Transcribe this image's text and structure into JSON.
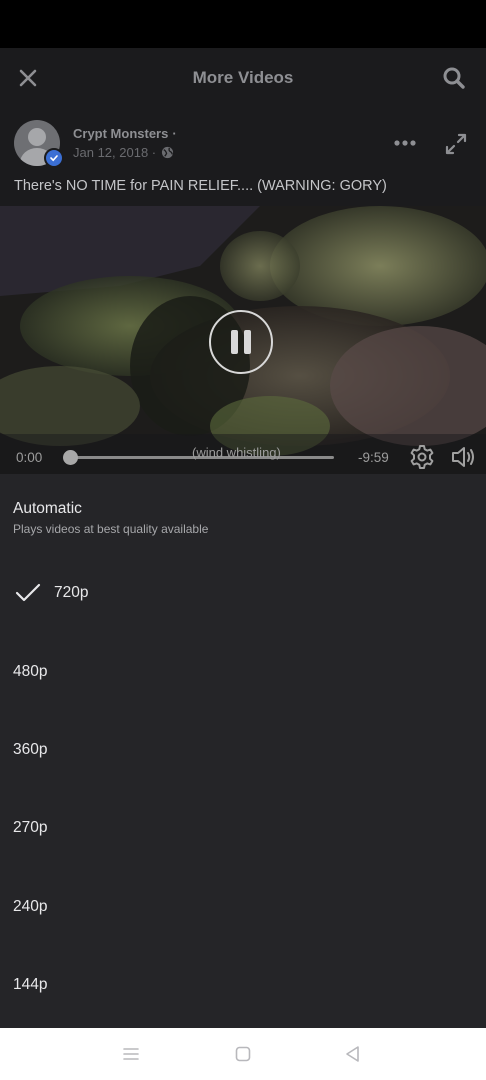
{
  "header": {
    "title": "More Videos",
    "close_icon": "close-icon",
    "search_icon": "search-icon"
  },
  "post": {
    "author": "Crypt Monsters",
    "author_separator": "·",
    "date": "Jan 12, 2018 ·",
    "audience_icon": "globe-icon",
    "verified_icon": "verified-badge-icon",
    "more_icon": "more-horizontal-icon",
    "expand_icon": "expand-icon",
    "caption": "There's NO TIME for PAIN RELIEF.... (WARNING: GORY)"
  },
  "player": {
    "state": "playing",
    "elapsed": "0:00",
    "remaining": "-9:59",
    "progress": 0.0,
    "subtitle": "(wind whistling)",
    "pause_icon": "pause-icon",
    "settings_icon": "gear-icon",
    "volume_icon": "volume-icon"
  },
  "quality": {
    "auto_title": "Automatic",
    "auto_subtitle": "Plays videos at best quality available",
    "selected": "720p",
    "options": [
      {
        "label": "720p",
        "selected": true
      },
      {
        "label": "480p",
        "selected": false
      },
      {
        "label": "360p",
        "selected": false
      },
      {
        "label": "270p",
        "selected": false
      },
      {
        "label": "240p",
        "selected": false
      },
      {
        "label": "144p",
        "selected": false
      }
    ]
  },
  "system_nav": {
    "menu_icon": "menu-icon",
    "home_icon": "home-square-icon",
    "back_icon": "back-triangle-icon"
  },
  "colors": {
    "accent": "#3b6fd4",
    "panel": "#252528",
    "header": "#1b1b1d"
  }
}
